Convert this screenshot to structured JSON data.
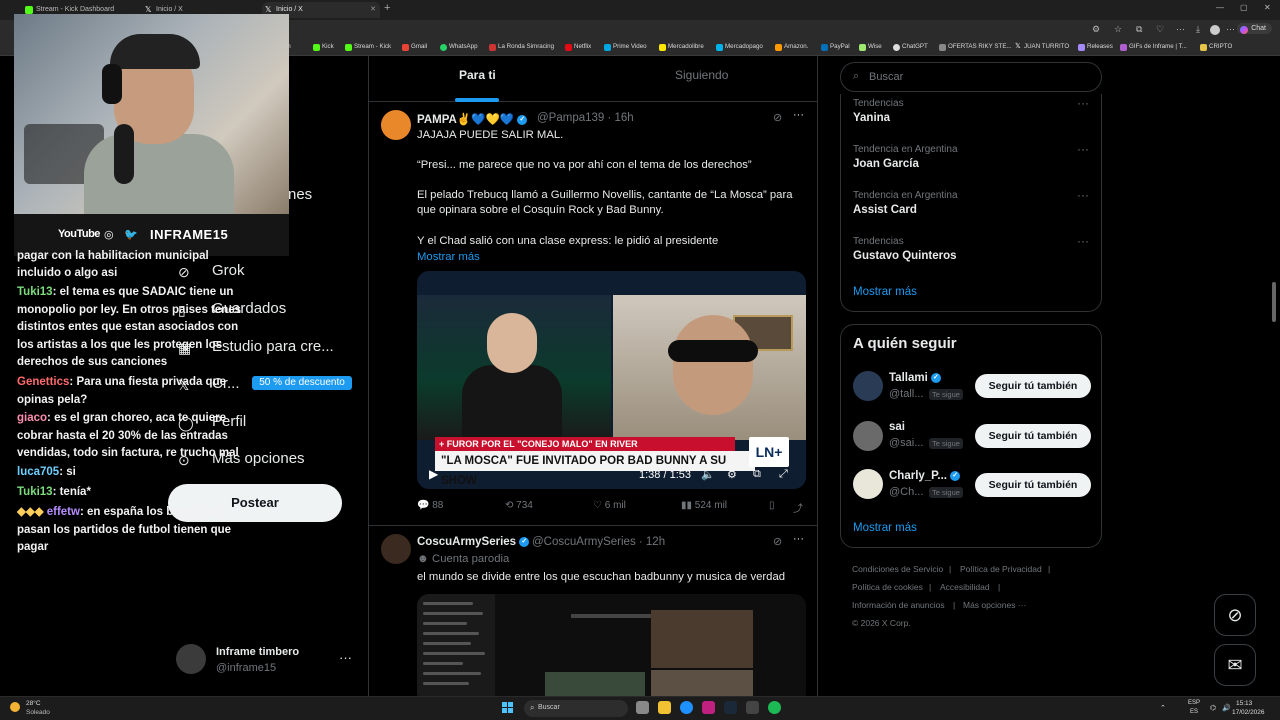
{
  "browser": {
    "tabs": [
      {
        "label": "Stream - Kick Dashboard"
      },
      {
        "label": "Inicio / X"
      },
      {
        "label": "Inicio / X"
      }
    ],
    "new_tab": "+",
    "chat_label": "Chat",
    "bookmarks": [
      "itch",
      "Kick",
      "Stream - Kick",
      "Gmail",
      "WhatsApp",
      "La Ronda Simracing",
      "Netflix",
      "Prime Video",
      "Mercadolibre",
      "Mercadopago",
      "Amazon.",
      "PayPal",
      "Wise",
      "ChatGPT",
      "OFERTAS RIKY STE...",
      "JUAN TURRITO",
      "Releases",
      "GIFs de Inframe | T...",
      "CRIPTO"
    ]
  },
  "overlay": {
    "youtube": "YouTube",
    "brand": "INFRAME15",
    "discount": "50 % de descuento"
  },
  "nav": {
    "items": [
      {
        "label": "Notificaciones",
        "visible": "nes"
      },
      {
        "label": "Grok"
      },
      {
        "label": "Guardados"
      },
      {
        "label": "Estudio para cre..."
      },
      {
        "label": "Cr...",
        "visible": "Cr..."
      },
      {
        "label": "Perfil",
        "visible": "Perfil"
      },
      {
        "label": "Más opciones"
      }
    ],
    "post_button": "Postear",
    "account": {
      "name": "Inframe timbero",
      "handle": "@inframe15",
      "more": "···"
    }
  },
  "chat": {
    "lines": [
      {
        "user": "",
        "text": "pagar con la habilitacion municipal"
      },
      {
        "user": "",
        "text": "incluido o algo asi"
      },
      {
        "user": "Tuki13",
        "user_color": "#7ddc7d",
        "text": ": el tema es que SADAIC tiene un monopolio por ley. En otros paises tenes distintos entes que estan asociados con los artistas a los que les protegen los derechos de sus canciones"
      },
      {
        "user": "Genettics",
        "user_color": "#ff6b6b",
        "text": ": Para una fiesta privada que opinas pela?"
      },
      {
        "user": "giaco",
        "user_color": "#ff8fb0",
        "text": ": es el gran choreo, aca te quiere cobrar hasta el 20 30% de las entradas vendidas, todo sin factura, re trucho mal"
      },
      {
        "user": "luca705",
        "user_color": "#6fd0ff",
        "text": ": si"
      },
      {
        "user": "Tuki13",
        "user_color": "#7ddc7d",
        "text": ": tenía*"
      },
      {
        "user": "effetw",
        "user_color": "#b58cff",
        "text": ": en españa los bares que pasan los partidos de futbol tienen que pagar"
      }
    ]
  },
  "timeline": {
    "tabs": [
      {
        "label": "Para ti"
      },
      {
        "label": "Siguiendo"
      }
    ],
    "posts": [
      {
        "name": "PAMPA✌️💙💛💙",
        "handle": "@Pampa139 · 16h",
        "lines": [
          "JAJAJA PUEDE SALIR MAL.",
          "“Presi... me parece que no va por ahí con el tema de los derechos”",
          "El pelado Trebucq llamó a Guillermo Novellis, cantante de “La Mosca” para que opinara sobre el Cosquín Rock y Bad Bunny.",
          "Y el  Chad salió con una clase express: le pidió al presidente"
        ],
        "show_more": "Mostrar más",
        "video": {
          "strip": "+ FUROR POR EL \"CONEJO MALO\" EN RIVER",
          "headline": "\"LA MOSCA\" FUE INVITADO POR BAD BUNNY A SU SHOW",
          "logo": "LN+",
          "time": "1:38 / 1:53"
        },
        "replies": "88",
        "reposts": "734",
        "likes": "6 mil",
        "views": "524 mil"
      },
      {
        "name": "CoscuArmySeries",
        "handle": "@CoscuArmySeries · 12h",
        "label": "Cuenta parodia",
        "text": "el mundo se divide entre los que escuchan badbunny y musica de verdad"
      }
    ]
  },
  "sidebar": {
    "search_placeholder": "Buscar",
    "trends": [
      {
        "context": "Tendencias",
        "name": "Yanina"
      },
      {
        "context": "Tendencia en Argentina",
        "name": "Joan García"
      },
      {
        "context": "Tendencia en Argentina",
        "name": "Assist Card"
      },
      {
        "context": "Tendencias",
        "name": "Gustavo Quinteros"
      }
    ],
    "trends_show_more": "Mostrar más",
    "who_to_follow": {
      "title": "A quién seguir",
      "users": [
        {
          "name": "Tallami",
          "handle": "@tall...",
          "badge": "Te sigue",
          "button": "Seguir tú también"
        },
        {
          "name": "sai",
          "handle": "@sai...",
          "badge": "Te sigue",
          "button": "Seguir tú también"
        },
        {
          "name": "Charly_P...",
          "handle": "@Ch...",
          "badge": "Te sigue",
          "button": "Seguir tú también"
        }
      ],
      "show_more": "Mostrar más"
    },
    "footer": [
      "Condiciones de Servicio",
      "|",
      "Política de Privacidad",
      "|",
      "Política de cookies",
      "|",
      "Accesibilidad",
      "|",
      "Información de anuncios",
      "|",
      "Más opciones ···",
      "© 2026 X Corp."
    ]
  },
  "taskbar": {
    "temp": "28°C",
    "weather": "Soleado",
    "search": "Buscar",
    "lang1": "ESP",
    "lang2": "ES",
    "time": "15:13",
    "date": "17/02/2026"
  }
}
